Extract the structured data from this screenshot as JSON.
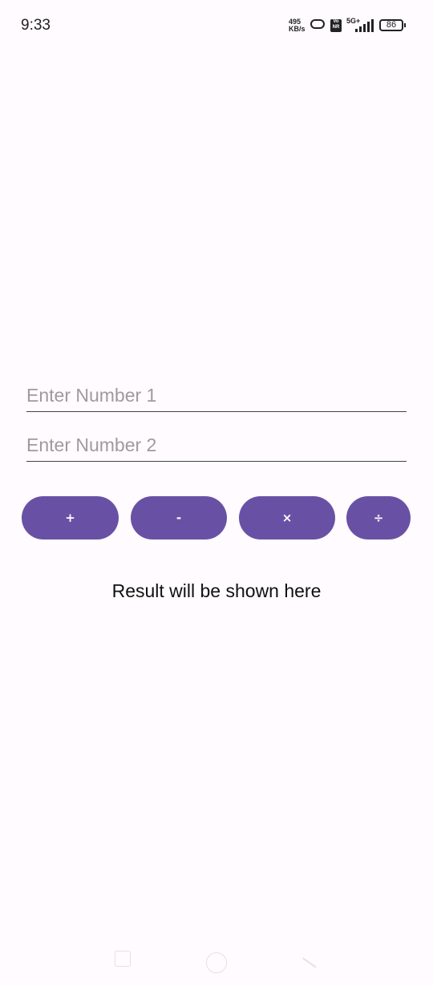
{
  "status_bar": {
    "time": "9:33",
    "speed_value": "495",
    "speed_unit": "KB/s",
    "vonr_top": "Vo",
    "vonr_bottom": "NR",
    "network": "5G+",
    "battery": "86"
  },
  "inputs": {
    "number1_placeholder": "Enter Number 1",
    "number2_placeholder": "Enter Number 2"
  },
  "buttons": {
    "add": "+",
    "subtract": "-",
    "multiply": "×",
    "divide": "÷"
  },
  "result": "Result will be shown here",
  "colors": {
    "accent": "#6851A5",
    "background": "#FFFBFE"
  }
}
